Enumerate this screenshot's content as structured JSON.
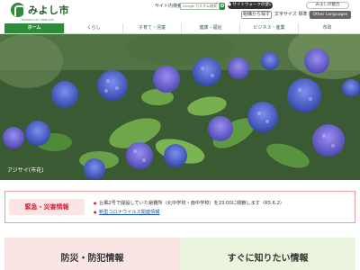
{
  "header": {
    "logo_name": "みよし市",
    "logo_sub": "MIYOSHI CITY WEB SITE",
    "sitemap_link": "サイト内検索",
    "search_placeholder": "Google カスタム検索",
    "readaloud": "● サイトウォークの使い方",
    "fontsize": "文字サイズ 標準 拡大",
    "find_button": "組織から探す",
    "sitemap_button": "▶ サイトマップ",
    "lang_button": "Other Languages",
    "right_pill": "みよしの魅力"
  },
  "nav": {
    "items": [
      "ホーム",
      "くらし",
      "子育て・児童",
      "健康・福祉",
      "ビジネス・産業",
      "市政"
    ],
    "active_index": 0
  },
  "hero": {
    "caption": "アジサイ(市花)"
  },
  "emergency": {
    "label": "緊急・災害情報",
    "items": [
      "台風2号で開設していた避難所（北中学校・南中学校）を23:00に閉鎖します（R5.6.2）",
      "新型コロナウイルス関連情報"
    ]
  },
  "bottom": {
    "left_title": "防災・防犯情報",
    "right_title": "すぐに知りたい情報"
  },
  "colors": {
    "brand_green": "#2f8a3c",
    "emergency_red": "#d0253b",
    "hydrangea_blue": "#4a63c9"
  }
}
